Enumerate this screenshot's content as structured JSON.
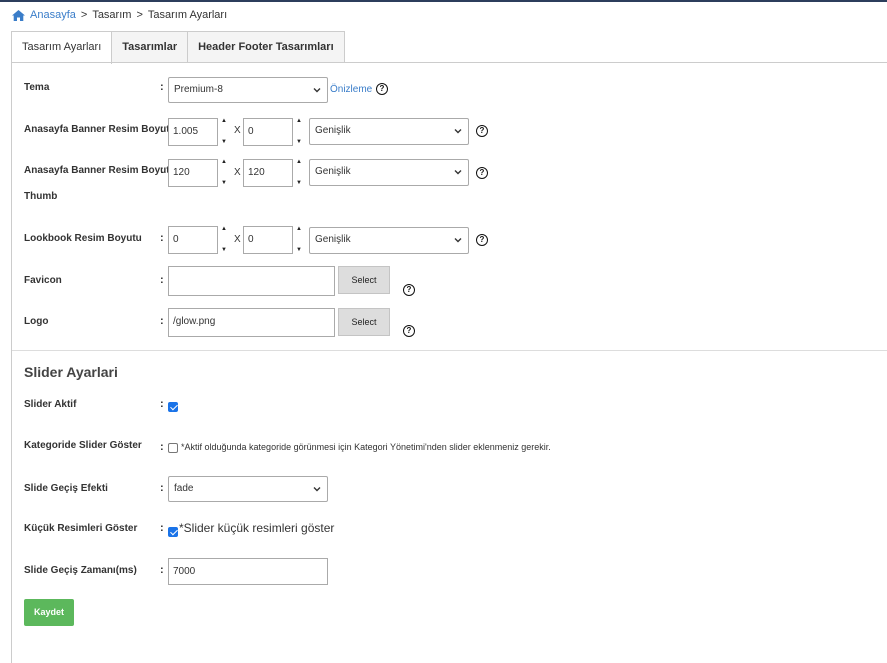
{
  "breadcrumb": {
    "home": "Anasayfa",
    "items": [
      "Tasarım",
      "Tasarım Ayarları"
    ]
  },
  "tabs": [
    {
      "label": "Tasarım Ayarları",
      "active": true
    },
    {
      "label": "Tasarımlar",
      "active": false
    },
    {
      "label": "Header Footer Tasarımları",
      "active": false
    }
  ],
  "colon": ":",
  "help_glyph": "?",
  "x_separator": "X",
  "form": {
    "tema": {
      "label": "Tema",
      "value": "Premium-8",
      "preview_link": "Önizleme"
    },
    "banner": {
      "label": "Anasayfa Banner Resim Boyutu",
      "width": "1.005",
      "height": "0",
      "mode": "Genişlik"
    },
    "banner_thumb": {
      "label_line1": "Anasayfa Banner Resim Boyutu",
      "label_line2": "Thumb",
      "width": "120",
      "height": "120",
      "mode": "Genişlik"
    },
    "lookbook": {
      "label": "Lookbook Resim Boyutu",
      "width": "0",
      "height": "0",
      "mode": "Genişlik"
    },
    "favicon": {
      "label": "Favicon",
      "value": "",
      "button": "Select"
    },
    "logo": {
      "label": "Logo",
      "value": "/glow.png",
      "button": "Select"
    }
  },
  "slider": {
    "title": "Slider Ayarlari",
    "aktif": {
      "label": "Slider Aktif",
      "checked": true
    },
    "kategoride": {
      "label": "Kategoride Slider Göster",
      "checked": false,
      "note": "*Aktif olduğunda kategoride görünmesi için Kategori Yönetimi'nden slider eklenmeniz gerekir."
    },
    "efekt": {
      "label": "Slide Geçiş Efekti",
      "value": "fade"
    },
    "kucuk": {
      "label": "Küçük Resimleri Göster",
      "checked": true,
      "note": "*Slider küçük resimleri göster"
    },
    "zaman": {
      "label": "Slide Geçiş Zamanı(ms)",
      "value": "7000"
    }
  },
  "save_button": "Kaydet",
  "colors": {
    "link": "#3a7dc9",
    "save": "#5cb85c",
    "checkbox": "#1a73e8"
  },
  "icons": [
    "home-icon",
    "help-icon",
    "chevron-down-icon",
    "spinner-up-icon",
    "spinner-down-icon",
    "checkbox-check-icon"
  ]
}
